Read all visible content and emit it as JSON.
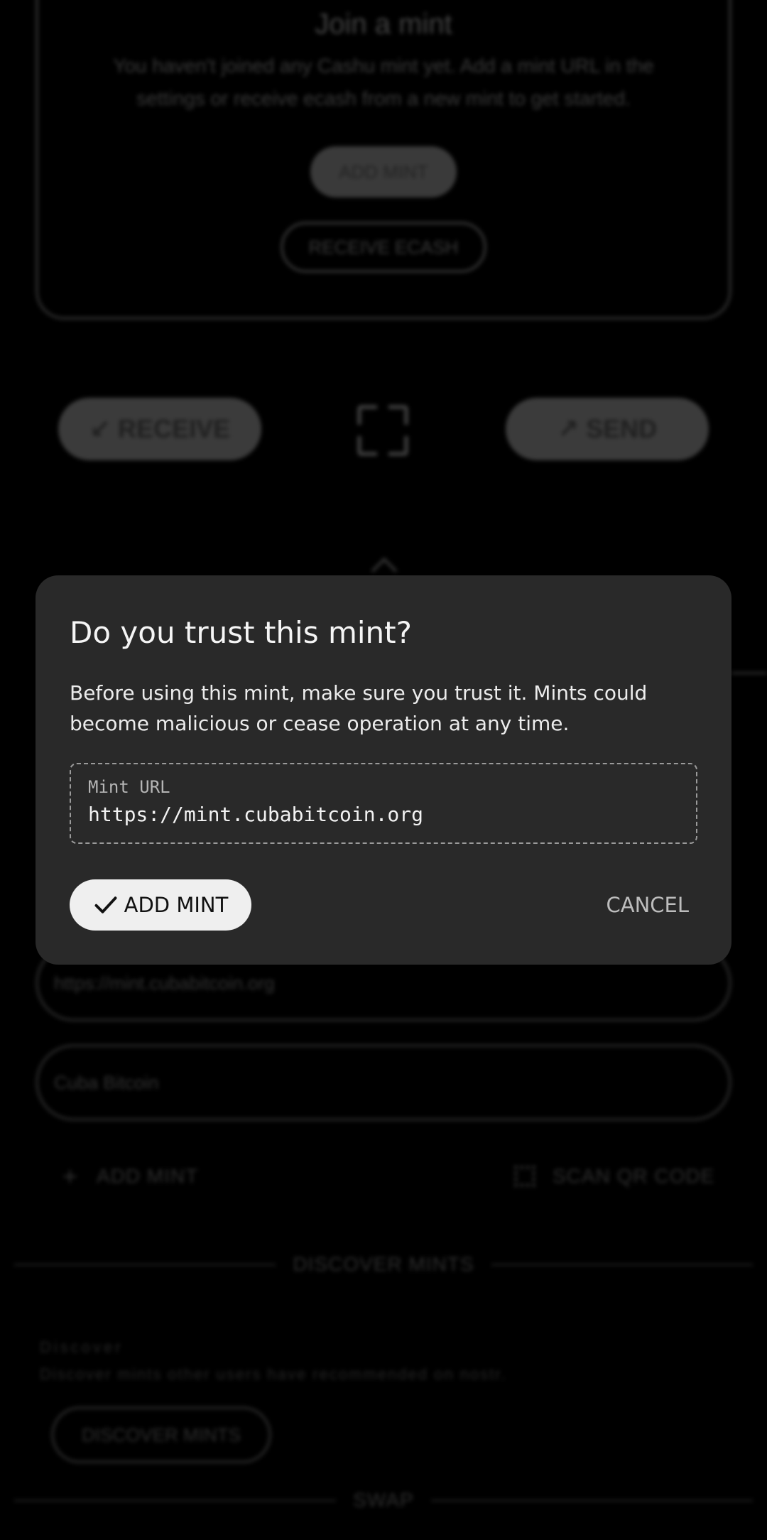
{
  "background": {
    "join_card": {
      "title": "Join a mint",
      "description": "You haven't joined any Cashu mint yet. Add a mint URL in the settings or receive ecash from a new mint to get started.",
      "add_mint_label": "ADD MINT",
      "receive_ecash_label": "RECEIVE ECASH"
    },
    "actions": {
      "receive_label": "↙ RECEIVE",
      "send_label": "↗ SEND"
    },
    "mint_url_field_value": "https://mint.cubabitcoin.org",
    "mint_name_field_value": "Cuba Bitcoin",
    "add_mint_link": "ADD MINT",
    "scan_qr_link": "SCAN QR CODE",
    "discover_divider": "DISCOVER MINTS",
    "discover_label": "Discover",
    "discover_desc": "Discover mints other users have recommended on nostr.",
    "discover_button": "DISCOVER MINTS",
    "swap_divider": "SWAP"
  },
  "dialog": {
    "title": "Do you trust this mint?",
    "body": "Before using this mint, make sure you trust it. Mints could become malicious or cease operation at any time.",
    "url_label": "Mint URL",
    "url_value": "https://mint.cubabitcoin.org",
    "confirm_label": "ADD MINT",
    "cancel_label": "CANCEL",
    "icons": {
      "confirm": "check-icon"
    },
    "colors": {
      "surface": "#292929",
      "confirm_bg": "#efefef",
      "text": "#f5f5f5"
    }
  }
}
